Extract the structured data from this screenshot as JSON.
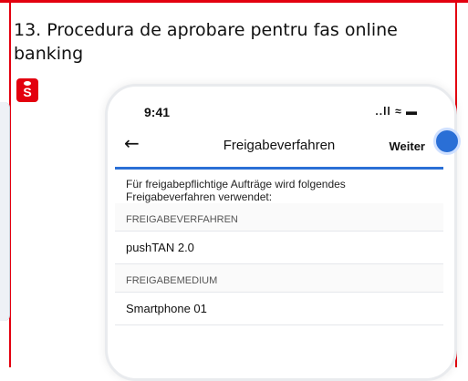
{
  "title": "13. Procedura de aprobare pentru fas online banking",
  "status": {
    "time": "9:41",
    "icons": "..ll ≈ ▬"
  },
  "header": {
    "title": "Freigabeverfahren",
    "action": "Weiter"
  },
  "content": {
    "intro": "Für freigabepflichtige Aufträge wird folgendes Freigabeverfahren verwendet:",
    "sections": [
      {
        "label": "FREIGABEVERFAHREN",
        "value": "pushTAN 2.0"
      },
      {
        "label": "FREIGABEMEDIUM",
        "value": "Smartphone 01"
      }
    ]
  },
  "colors": {
    "accent": "#2a6fd6",
    "brand": "#e3000f"
  },
  "icons": {
    "logo": "sparkasse-logo-icon",
    "back": "back-arrow-icon"
  }
}
